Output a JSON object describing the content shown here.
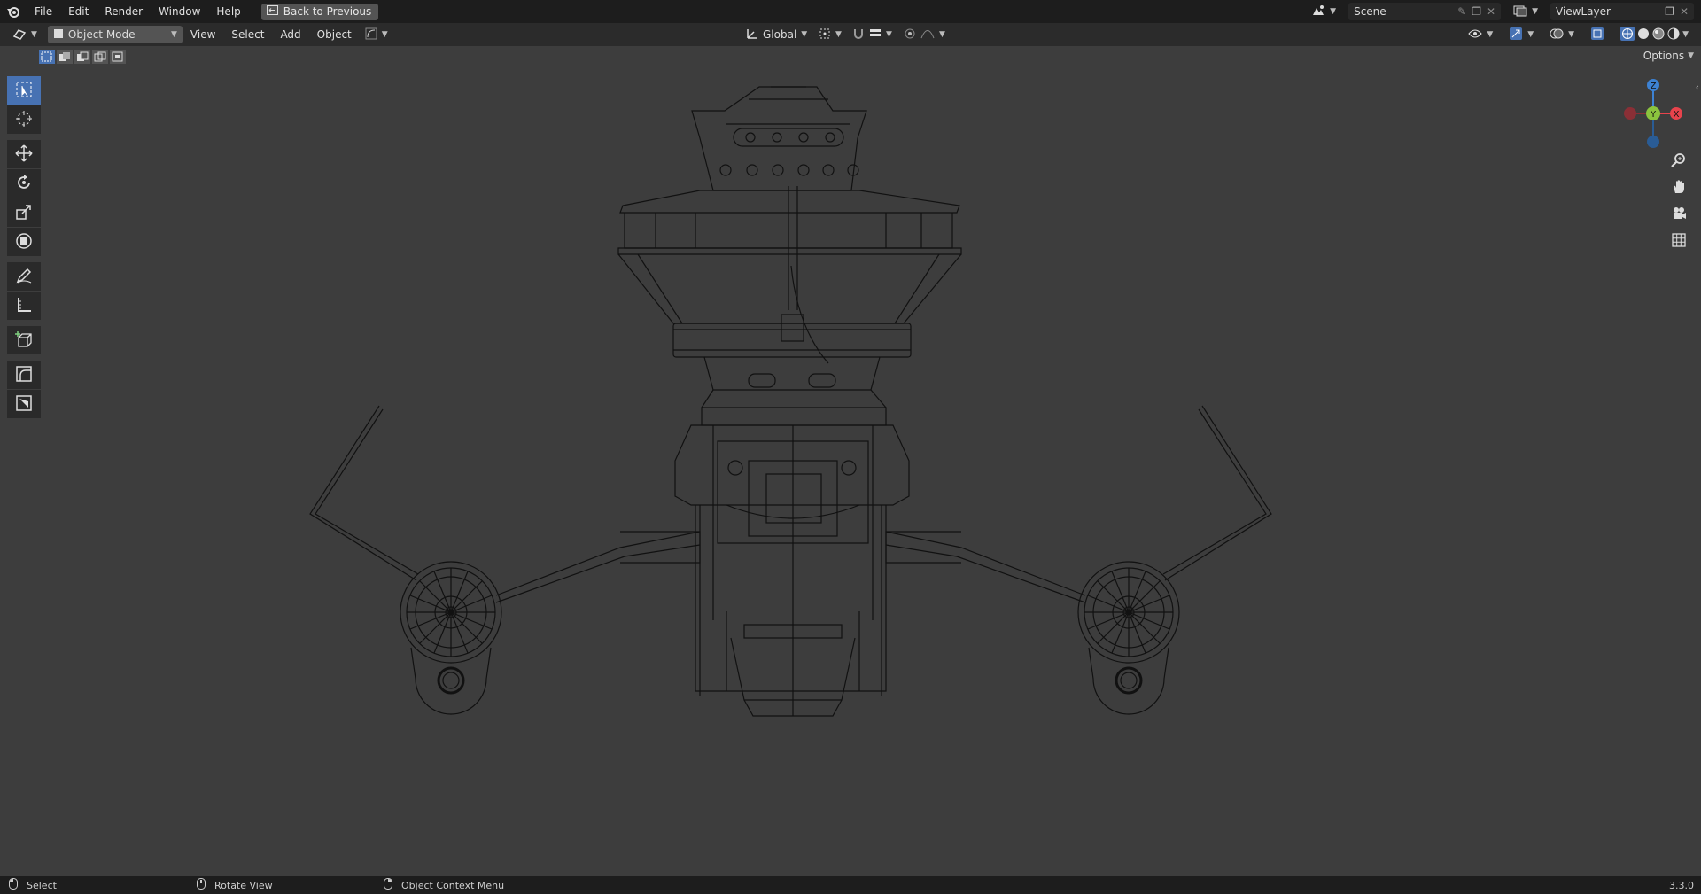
{
  "topbar": {
    "menus": [
      "File",
      "Edit",
      "Render",
      "Window",
      "Help"
    ],
    "back_button": "Back to Previous",
    "scene": "Scene",
    "view_layer": "ViewLayer"
  },
  "header": {
    "mode": "Object Mode",
    "menus": [
      "View",
      "Select",
      "Add",
      "Object"
    ],
    "orientation": "Global"
  },
  "options_label": "Options",
  "gizmo": {
    "z": "Z",
    "y": "Y",
    "x": "X"
  },
  "toolbar": {
    "tools": [
      "select-box",
      "cursor",
      "move",
      "rotate",
      "scale",
      "transform",
      "annotate",
      "measure",
      "add-cube",
      "extrude",
      "knife"
    ]
  },
  "statusbar": {
    "select": "Select",
    "rotate": "Rotate View",
    "context": "Object Context Menu",
    "version": "3.3.0"
  },
  "colors": {
    "accent": "#4772b3",
    "x_axis": "#e8434c",
    "y_axis": "#8bc43e",
    "z_axis": "#3d82d3"
  }
}
